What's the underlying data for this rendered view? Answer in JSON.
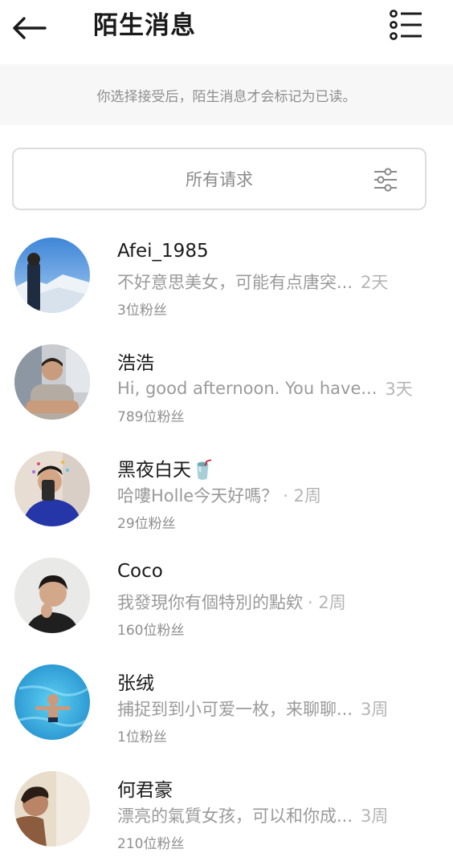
{
  "header": {
    "title": "陌生消息",
    "back_icon": "arrow-left-icon",
    "menu_icon": "list-menu-icon"
  },
  "notice": {
    "text": "你选择接受后，陌生消息才会标记为已读。"
  },
  "filter": {
    "label": "所有请求",
    "icon": "sliders-icon"
  },
  "requests": [
    {
      "name": "Afei_1985",
      "message": "不好意思美女，可能有点唐突...",
      "time": "2天",
      "followers": "3位粉丝"
    },
    {
      "name": "浩浩",
      "message": "Hi, good afternoon. You have...",
      "time": "3天",
      "followers": "789位粉丝"
    },
    {
      "name": "黑夜白天🥤",
      "message": "哈嘍Holle今天好嗎？",
      "time": " · 2周",
      "followers": "29位粉丝"
    },
    {
      "name": "Coco",
      "message": "我發現你有個特別的點欸",
      "time": " · 2周",
      "followers": "160位粉丝"
    },
    {
      "name": "张绒",
      "message": "捕捉到到小可爱一枚，来聊聊...",
      "time": "3周",
      "followers": "1位粉丝"
    },
    {
      "name": "何君豪",
      "message": "漂亮的氣質女孩，可以和你成...",
      "time": "3周",
      "followers": "210位粉丝"
    }
  ],
  "colors": {
    "background": "#ffffff",
    "notice_bg": "#f7f7f7",
    "border": "#dcdcdc",
    "primary_text": "#1a1a1a",
    "secondary_text": "#9a9a9a"
  }
}
